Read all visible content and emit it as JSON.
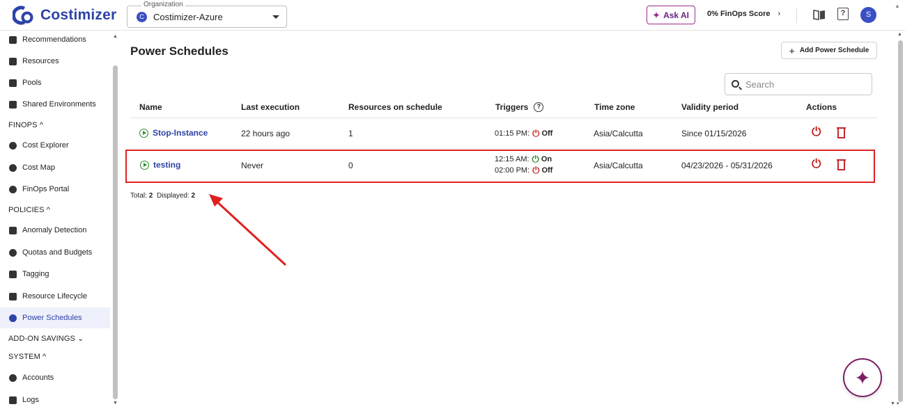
{
  "app": {
    "logo_text": "Costimizer",
    "organization_legend": "Organization",
    "organization_avatar": "C",
    "organization_value": "Costimizer-Azure",
    "ask_ai_label": "Ask AI",
    "finops_score": "0% FinOps Score",
    "user_initial": "S",
    "accent_color": "#2e43a6",
    "danger_color": "#c62828",
    "success_color": "#2e8b2e"
  },
  "sidebar": {
    "items_top": [
      {
        "label": "Recommendations",
        "icon": "thumbs-up-icon"
      },
      {
        "label": "Resources",
        "icon": "bar-chart-icon"
      },
      {
        "label": "Pools",
        "icon": "pools-icon"
      },
      {
        "label": "Shared Environments",
        "icon": "shared-env-icon"
      }
    ],
    "section_finops": "FINOPS ^",
    "items_finops": [
      {
        "label": "Cost Explorer",
        "icon": "compass-icon"
      },
      {
        "label": "Cost Map",
        "icon": "globe-icon"
      },
      {
        "label": "FinOps Portal",
        "icon": "dollar-icon"
      }
    ],
    "section_policies": "POLICIES ^",
    "items_policies": [
      {
        "label": "Anomaly Detection",
        "icon": "anomaly-icon"
      },
      {
        "label": "Quotas and Budgets",
        "icon": "budget-icon"
      },
      {
        "label": "Tagging",
        "icon": "tag-icon"
      },
      {
        "label": "Resource Lifecycle",
        "icon": "lifecycle-icon"
      },
      {
        "label": "Power Schedules",
        "icon": "clock-icon",
        "active": true
      }
    ],
    "section_addon": "ADD-ON SAVINGS ⌄",
    "section_system": "SYSTEM ^",
    "items_system": [
      {
        "label": "Accounts",
        "icon": "cloud-icon"
      },
      {
        "label": "Logs",
        "icon": "logs-icon"
      }
    ]
  },
  "main": {
    "title": "Power Schedules",
    "add_button": "Add Power Schedule",
    "search_placeholder": "Search",
    "columns": [
      "Name",
      "Last execution",
      "Resources on schedule",
      "Triggers",
      "Time zone",
      "Validity period",
      "Actions"
    ],
    "rows": [
      {
        "name": "Stop-Instance",
        "last_execution": "22 hours ago",
        "resources": "1",
        "triggers": [
          {
            "time": "01:15 PM:",
            "state": "Off"
          }
        ],
        "time_zone": "Asia/Calcutta",
        "validity": "Since 01/15/2026"
      },
      {
        "name": "testing",
        "last_execution": "Never",
        "resources": "0",
        "triggers": [
          {
            "time": "12:15 AM:",
            "state": "On"
          },
          {
            "time": "02:00 PM:",
            "state": "Off"
          }
        ],
        "time_zone": "Asia/Calcutta",
        "validity": "04/23/2026 - 05/31/2026"
      }
    ],
    "totals_label": "Total:",
    "total": "2",
    "displayed_label": "Displayed:",
    "displayed": "2"
  }
}
